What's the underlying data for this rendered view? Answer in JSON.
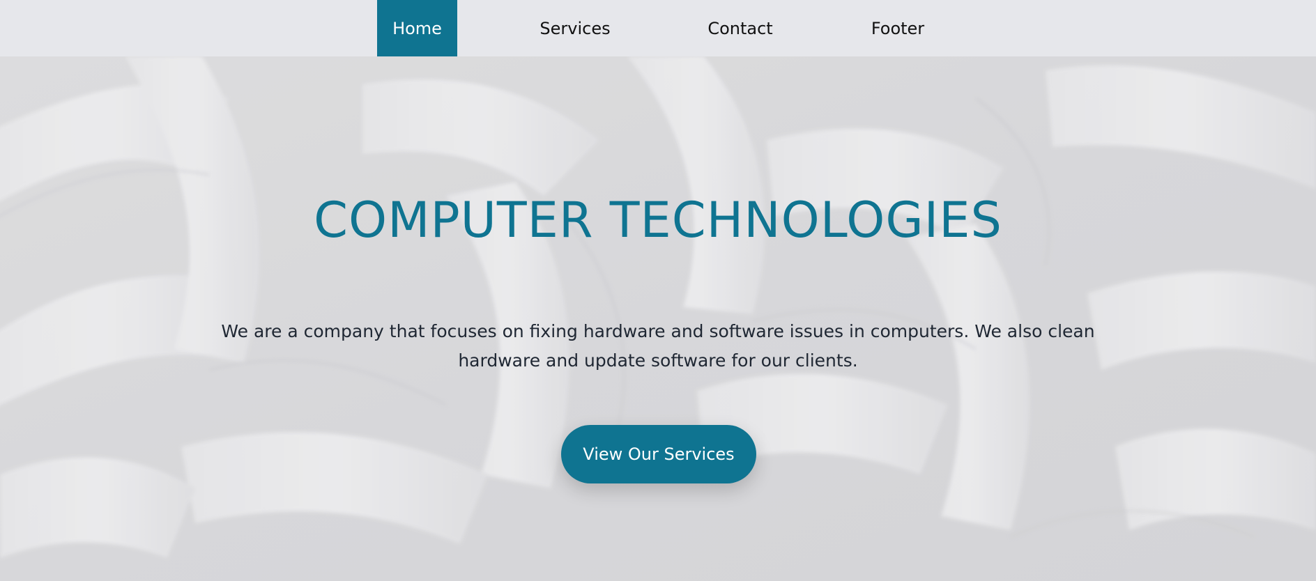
{
  "colors": {
    "accent": "#0f7491",
    "nav_bg": "#e6e7eb",
    "text_dark": "#1f2733"
  },
  "nav": {
    "items": [
      {
        "label": "Home",
        "active": true
      },
      {
        "label": "Services",
        "active": false
      },
      {
        "label": "Contact",
        "active": false
      },
      {
        "label": "Footer",
        "active": false
      }
    ]
  },
  "hero": {
    "title": "COMPUTER TECHNOLOGIES",
    "description": "We are a company that focuses on fixing hardware and software issues in computers. We also clean hardware and update software for our clients.",
    "cta_label": "View Our Services",
    "background": "abstract-white-woven-pattern"
  }
}
